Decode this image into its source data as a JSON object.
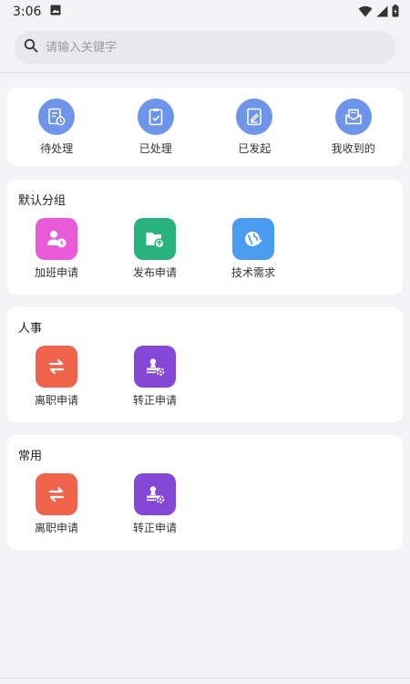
{
  "status_bar": {
    "time": "3:06"
  },
  "search": {
    "placeholder": "请输入关键字"
  },
  "quick_actions": [
    {
      "label": "待处理",
      "icon": "pending-icon"
    },
    {
      "label": "已处理",
      "icon": "processed-icon"
    },
    {
      "label": "已发起",
      "icon": "initiated-icon"
    },
    {
      "label": "我收到的",
      "icon": "inbox-icon"
    }
  ],
  "groups": [
    {
      "title": "默认分组",
      "items": [
        {
          "label": "加班申请",
          "icon": "overtime-icon",
          "color": "#e95ad8"
        },
        {
          "label": "发布申请",
          "icon": "publish-icon",
          "color": "#27b27e"
        },
        {
          "label": "技术需求",
          "icon": "tech-icon",
          "color": "#4a9cf0"
        }
      ]
    },
    {
      "title": "人事",
      "items": [
        {
          "label": "离职申请",
          "icon": "resign-icon",
          "color": "#f0644c"
        },
        {
          "label": "转正申请",
          "icon": "regularize-icon",
          "color": "#8447d6"
        }
      ]
    },
    {
      "title": "常用",
      "items": [
        {
          "label": "离职申请",
          "icon": "resign-icon",
          "color": "#f0644c"
        },
        {
          "label": "转正申请",
          "icon": "regularize-icon",
          "color": "#8447d6"
        }
      ]
    }
  ],
  "colors": {
    "quick_icon_bg": "#6f95ea",
    "background": "#f3f3f5"
  }
}
